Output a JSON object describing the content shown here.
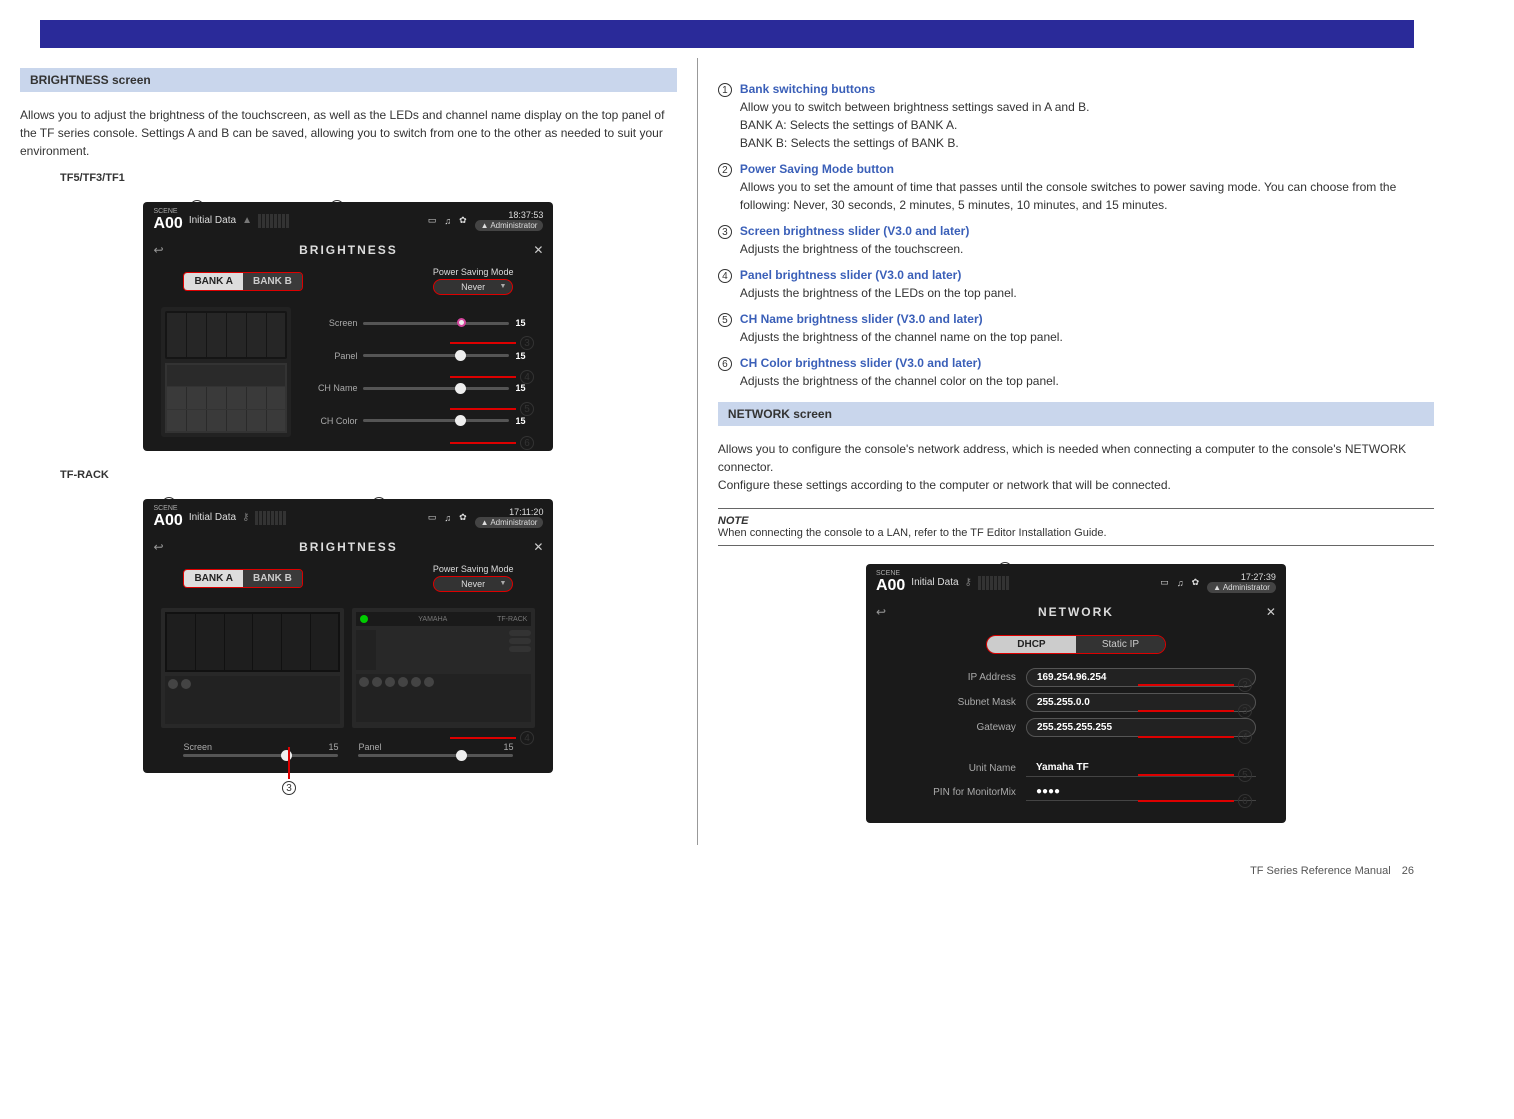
{
  "header_section": "Toolbar",
  "brightness": {
    "section_title": "BRIGHTNESS screen",
    "intro": "Allows you to adjust the brightness of the touchscreen, as well as the LEDs and channel name display on the top panel of the TF series console. Settings A and B can be saved, allowing you to switch from one to the other as needed to suit your environment.",
    "ss_title": "BRIGHTNESS",
    "scene_id": "A00",
    "scene_name": "Initial Data",
    "time1": "18:37:53",
    "time2": "17:11:20",
    "admin": "Administrator",
    "bank_a": "BANK A",
    "bank_b": "BANK B",
    "psm_label": "Power Saving Mode",
    "psm_value": "Never",
    "sliders": [
      {
        "label": "Screen",
        "value": "15"
      },
      {
        "label": "Panel",
        "value": "15"
      },
      {
        "label": "CH Name",
        "value": "15"
      },
      {
        "label": "CH Color",
        "value": "15"
      }
    ],
    "rack_label": "TF-RACK",
    "callouts": {
      "c1": "1",
      "c2": "2",
      "c3": "3",
      "c4": "4",
      "c5": "5",
      "c6": "6"
    },
    "series_label": "TF5/TF3/TF1",
    "rack_series": "TF-RACK",
    "items": [
      {
        "n": "1",
        "title": "Bank switching buttons",
        "body": "Allow you to switch between brightness settings saved in A and B.\nBANK A: Selects the settings of BANK A.\nBANK B: Selects the settings of BANK B."
      },
      {
        "n": "2",
        "title": "Power Saving Mode button",
        "body": "Allows you to set the amount of time that passes until the console switches to power saving mode.\nYou can choose from the following: Never, 30 seconds, 2 minutes, 5 minutes, 10 minutes, and 15 minutes."
      },
      {
        "n": "3",
        "title": "Screen brightness slider (V3.0 and later)",
        "body": "Adjusts the brightness of the touchscreen."
      },
      {
        "n": "4",
        "title": "Panel brightness slider (V3.0 and later)",
        "body": "Adjusts the brightness of the LEDs on the top panel."
      },
      {
        "n": "5",
        "title": "CH Name brightness slider (V3.0 and later)",
        "body": "Adjusts the brightness of the channel name on the top panel."
      },
      {
        "n": "6",
        "title": "CH Color brightness slider (V3.0 and later)",
        "body": "Adjusts the brightness of the channel color on the top panel."
      }
    ]
  },
  "network": {
    "section_title": "NETWORK screen",
    "intro": "Allows you to configure the console's network address, which is needed when connecting a computer to the console's NETWORK connector.\nConfigure these settings according to the computer or network that will be connected.",
    "note_label": "NOTE",
    "note_body": "When connecting the console to a LAN, refer to the TF Editor Installation Guide.",
    "ss_title": "NETWORK",
    "scene_id": "A00",
    "scene_name": "Initial Data",
    "time": "17:27:39",
    "admin": "Administrator",
    "dhcp": "DHCP",
    "static": "Static IP",
    "rows": [
      {
        "label": "IP Address",
        "value": "169.254.96.254"
      },
      {
        "label": "Subnet Mask",
        "value": "255.255.0.0"
      },
      {
        "label": "Gateway",
        "value": "255.255.255.255"
      }
    ],
    "unit_label": "Unit Name",
    "unit_value": "Yamaha TF",
    "pin_label": "PIN for MonitorMix",
    "pin_value": "●●●●",
    "callouts": {
      "c1": "1",
      "c2": "2",
      "c3": "3",
      "c4": "4",
      "c5": "5",
      "c6": "6"
    }
  },
  "footer": {
    "product": "TF Series Reference Manual",
    "page": "26"
  }
}
